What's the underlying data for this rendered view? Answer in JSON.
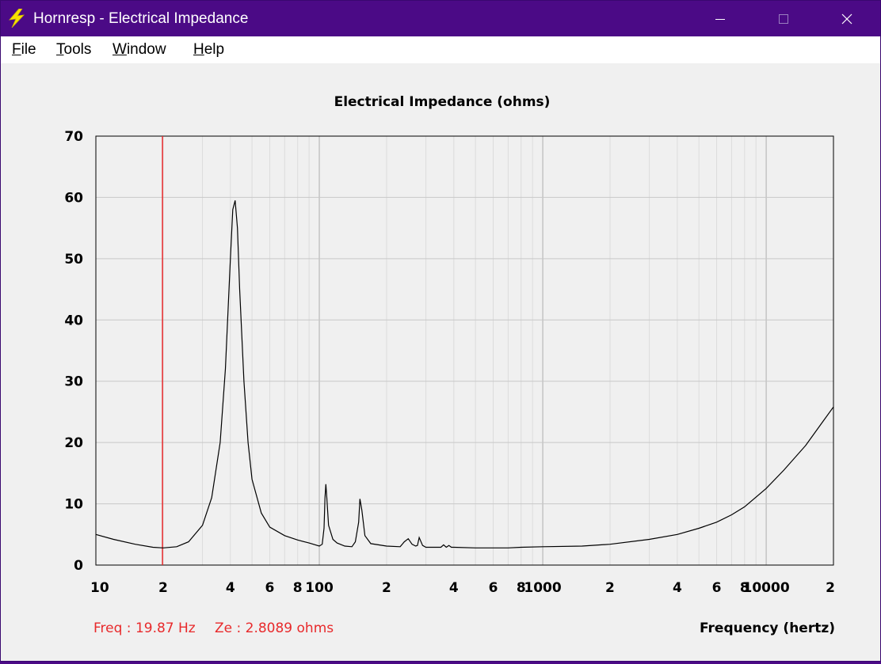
{
  "window": {
    "title": "Hornresp - Electrical Impedance"
  },
  "menu": {
    "items": [
      {
        "label": "File",
        "accel": "F",
        "rest": "ile"
      },
      {
        "label": "Tools",
        "accel": "T",
        "rest": "ools"
      },
      {
        "label": "Window",
        "accel": "W",
        "rest": "indow"
      },
      {
        "label": "Help",
        "accel": "H",
        "rest": "elp"
      }
    ]
  },
  "readout": {
    "freq": "Freq : 19.87 Hz",
    "ze": "Ze : 2.8089 ohms"
  },
  "colors": {
    "titlebar": "#4b0a86",
    "trace": "#000000",
    "cursor": "#e8292b",
    "readout": "#e8292b",
    "grid": "#c8c8c8"
  },
  "chart_data": {
    "type": "line",
    "title": "Electrical Impedance (ohms)",
    "xlabel": "Frequency (hertz)",
    "ylabel": "",
    "x_scale": "log",
    "xlim": [
      10,
      20000
    ],
    "ylim": [
      0,
      70
    ],
    "y_ticks": [
      0,
      10,
      20,
      30,
      40,
      50,
      60,
      70
    ],
    "x_ticks": [
      {
        "value": 10,
        "label": "10"
      },
      {
        "value": 20,
        "label": "2"
      },
      {
        "value": 40,
        "label": "4"
      },
      {
        "value": 60,
        "label": "6"
      },
      {
        "value": 80,
        "label": "8"
      },
      {
        "value": 100,
        "label": "100"
      },
      {
        "value": 200,
        "label": "2"
      },
      {
        "value": 400,
        "label": "4"
      },
      {
        "value": 600,
        "label": "6"
      },
      {
        "value": 800,
        "label": "8"
      },
      {
        "value": 1000,
        "label": "1000"
      },
      {
        "value": 2000,
        "label": "2"
      },
      {
        "value": 4000,
        "label": "4"
      },
      {
        "value": 6000,
        "label": "6"
      },
      {
        "value": 8000,
        "label": "8"
      },
      {
        "value": 10000,
        "label": "10000"
      },
      {
        "value": 20000,
        "label": "2"
      }
    ],
    "grid": true,
    "cursor_x": 19.87,
    "series": [
      {
        "x": [
          10,
          12,
          15,
          18,
          20,
          23,
          26,
          30,
          33,
          36,
          38,
          40,
          41,
          42,
          43,
          44,
          46,
          48,
          50,
          55,
          60,
          70,
          80,
          90,
          100,
          103,
          105,
          106,
          107,
          108,
          110,
          115,
          120,
          130,
          140,
          145,
          150,
          152,
          155,
          160,
          170,
          200,
          230,
          240,
          250,
          260,
          270,
          275,
          280,
          290,
          300,
          350,
          360,
          370,
          380,
          390,
          400,
          500,
          600,
          700,
          800,
          1000,
          1500,
          2000,
          3000,
          4000,
          5000,
          6000,
          7000,
          8000,
          10000,
          12000,
          15000,
          18000,
          20000
        ],
        "values": [
          5.0,
          4.2,
          3.4,
          2.9,
          2.8,
          3.0,
          3.8,
          6.5,
          11.0,
          20.0,
          32.0,
          50.0,
          58.0,
          59.5,
          55.0,
          45.0,
          30.0,
          20.0,
          14.0,
          8.5,
          6.2,
          4.8,
          4.1,
          3.6,
          3.1,
          3.4,
          6.0,
          11.0,
          13.2,
          11.0,
          6.5,
          4.2,
          3.6,
          3.1,
          3.0,
          3.8,
          7.0,
          10.8,
          9.0,
          4.8,
          3.5,
          3.1,
          3.0,
          3.8,
          4.3,
          3.4,
          3.1,
          3.2,
          4.5,
          3.2,
          2.9,
          2.9,
          3.3,
          2.9,
          3.2,
          2.9,
          2.9,
          2.8,
          2.8,
          2.8,
          2.9,
          3.0,
          3.1,
          3.4,
          4.2,
          5.0,
          6.0,
          7.0,
          8.2,
          9.5,
          12.5,
          15.5,
          19.5,
          23.5,
          25.8
        ]
      }
    ]
  }
}
